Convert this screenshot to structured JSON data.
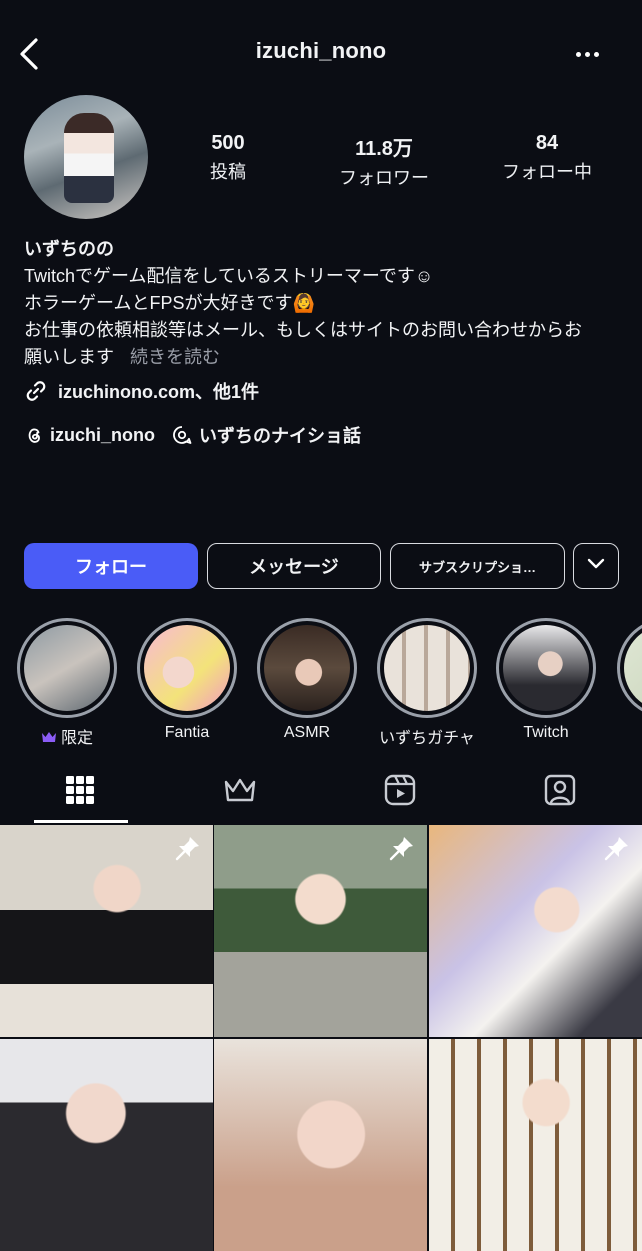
{
  "header": {
    "username": "izuchi_nono"
  },
  "stats": [
    {
      "count": "500",
      "label": "投稿"
    },
    {
      "count": "11.8万",
      "label": "フォロワー"
    },
    {
      "count": "84",
      "label": "フォロー中"
    }
  ],
  "bio": {
    "name": "いずちのの",
    "lines": [
      "Twitchでゲーム配信をしているストリーマーです☺︎",
      "ホラーゲームとFPSが大好きです🙆",
      "お仕事の依頼相談等はメール、もしくはサイトのお問い合わせからお",
      "願いします"
    ],
    "more": "続きを読む"
  },
  "links": {
    "website": "izuchinono.com、他1件",
    "threads": "izuchi_nono",
    "channel": "いずちのナイショ話"
  },
  "actions": {
    "follow": "フォロー",
    "message": "メッセージ",
    "subscription": "サブスクリプショ…"
  },
  "highlights": [
    {
      "label": "限定"
    },
    {
      "label": "Fantia"
    },
    {
      "label": "ASMR"
    },
    {
      "label": "いずちガチャ"
    },
    {
      "label": "Twitch"
    }
  ],
  "tabs": [
    "grid",
    "subscriber",
    "reels",
    "tagged"
  ],
  "colors": {
    "background": "#0b0d14",
    "follow_button": "#4a5cf7",
    "subscriber_crown": "#8b5cf6"
  }
}
